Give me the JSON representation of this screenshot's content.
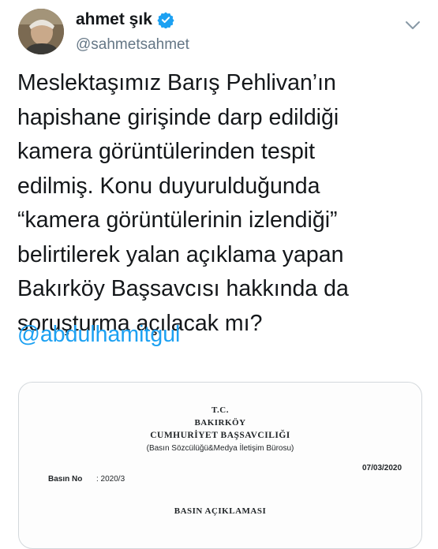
{
  "author": {
    "name": "ahmet şık",
    "handle": "@sahmetsahmet",
    "verified": true,
    "avatar_icon": "user-avatar"
  },
  "tweet": {
    "lines": [
      "Meslektaşımız Barış Pehlivan’ın",
      "hapishane girişinde darp edildiği",
      "kamera görüntülerinden tespit",
      "edilmiş. Konu duyurulduğunda",
      "“kamera görüntülerinin izlendiği”",
      "belirtilerek yalan açıklama yapan",
      "Bakırköy Başsavcısı hakkında da",
      "soruşturma açılacak mı?"
    ],
    "mention": "@abdulhamitgul"
  },
  "document": {
    "header_line1": "T.C.",
    "header_line2": "BAKIRKÖY",
    "header_line3": "CUMHURİYET BAŞSAVCILIĞI",
    "header_line4": "(Basın Sözcülüğü&Medya İletişim Bürosu)",
    "date": "07/03/2020",
    "no_label": "Basın No",
    "no_value": ": 2020/3",
    "title": "BASIN AÇIKLAMASI"
  },
  "colors": {
    "accent": "#1da1f2",
    "text": "#14171a",
    "secondary": "#657786"
  }
}
